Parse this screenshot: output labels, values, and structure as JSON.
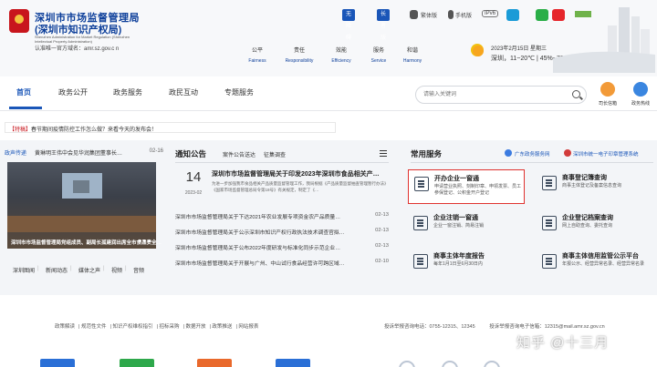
{
  "header": {
    "org_name": "深圳市市场监督管理局",
    "org_sub": "(深圳市知识产权局)",
    "org_en": "Shenzhen Administration for Market Regulation (Shenzhen Intellectual Property Administration)",
    "auth_label": "认准唯一官方域名：amr.sz.gov.c n",
    "values": [
      {
        "cn": "公平",
        "en": "Fairness"
      },
      {
        "cn": "责任",
        "en": "Responsibility"
      },
      {
        "cn": "效能",
        "en": "Efficiency"
      },
      {
        "cn": "服务",
        "en": "Service"
      },
      {
        "cn": "和谐",
        "en": "Harmony"
      }
    ],
    "topbar": {
      "barrier_free": "无障碍",
      "elder_version": "长者版",
      "traditional": "繁体版",
      "mobile": "手机版",
      "ipv6": "IPv6"
    },
    "weather": {
      "date": "2023年2月15日 星期三",
      "city": "深圳",
      "temp": "11~20℃",
      "humidity": "45%~70%"
    }
  },
  "nav": {
    "items": [
      "首页",
      "政务公开",
      "政务服务",
      "政民互动",
      "专题服务"
    ],
    "search_placeholder": "请输入关键词",
    "robots": [
      "司长信箱",
      "政务热线"
    ]
  },
  "ticker": {
    "tag": "【特稿】",
    "text": "春节期间疫情防控工作怎么做？来看今天的发布会！"
  },
  "news": {
    "tag": "政声传递",
    "title": "黄琳明王伟中会见华润集团董事长…",
    "date": "02-16",
    "caption": "深圳市市场监督管理局党组成员、副局长孤建润出席全市食品安全…",
    "tabs": [
      "深圳图闻",
      "新闻动态",
      "媒体之声",
      "视频",
      "音频"
    ]
  },
  "notices": {
    "tabs": [
      "通知公告",
      "案件公告送达",
      "征集调查"
    ],
    "headline": {
      "day": "14",
      "ym": "2023-02",
      "title": "深圳市市场监督管理局关于印发2023年深圳市食品相关产…",
      "desc": "为进一步加强我市食品相关产品质量监督管理工作，我局根据《产品质量监督抽查管理暂行办法》《国家市场监督管理总局令第18号》有关规定，制定了《…"
    },
    "list": [
      {
        "title": "深圳市市场监督管理局关于下达2021年农业发展专项资金农产品质量…",
        "date": "02-13"
      },
      {
        "title": "深圳市市场监督管理局关于公示深圳市知识产权行政执法技术调查官拟…",
        "date": "02-13"
      },
      {
        "title": "深圳市市场监督管理局关于公布2022年度研发与标准化同步示范企业…",
        "date": "02-13"
      },
      {
        "title": "深圳市市场监督管理局关于开展与广州、中山试行食品经营许可跨区域…",
        "date": "02-10"
      }
    ]
  },
  "services": {
    "title": "常用服务",
    "links": [
      "广东政务服务网",
      "深圳市统一电子印章管理系统"
    ],
    "cards": [
      {
        "name": "开办企业一窗通",
        "desc": "申请营业执照、刻制印章、申领发票、员工参保登记、公积金开户登记"
      },
      {
        "name": "商事登记簿查询",
        "desc": "商事主体登记及备案信息查询"
      },
      {
        "name": "企业注销一窗通",
        "desc": "企业一窗注销、简易注销"
      },
      {
        "name": "企业登记档案查询",
        "desc": "网上自助查询、委托查询"
      },
      {
        "name": "商事主体年度报告",
        "desc": "每年1月1日至6月30日内"
      },
      {
        "name": "商事主体信用监管公示平台",
        "desc": "年报公示、经营异常名录、经营异常名录"
      }
    ]
  },
  "footer": {
    "links": [
      "政策解读",
      "规范性文件",
      "知识产权维权指引",
      "招标采购",
      "数据开放",
      "政策推送",
      "网站报表"
    ],
    "hotline": "投诉举报咨询电话：0755-12315、12345",
    "email": "投诉举报咨询电子信箱：12315@mail.amr.sz.gov.cn"
  },
  "watermark": "知乎 @十三月",
  "colors": {
    "brand_blue": "#1a56b8",
    "highlight_red": "#e0322f",
    "emblem_red": "#c8161d"
  }
}
